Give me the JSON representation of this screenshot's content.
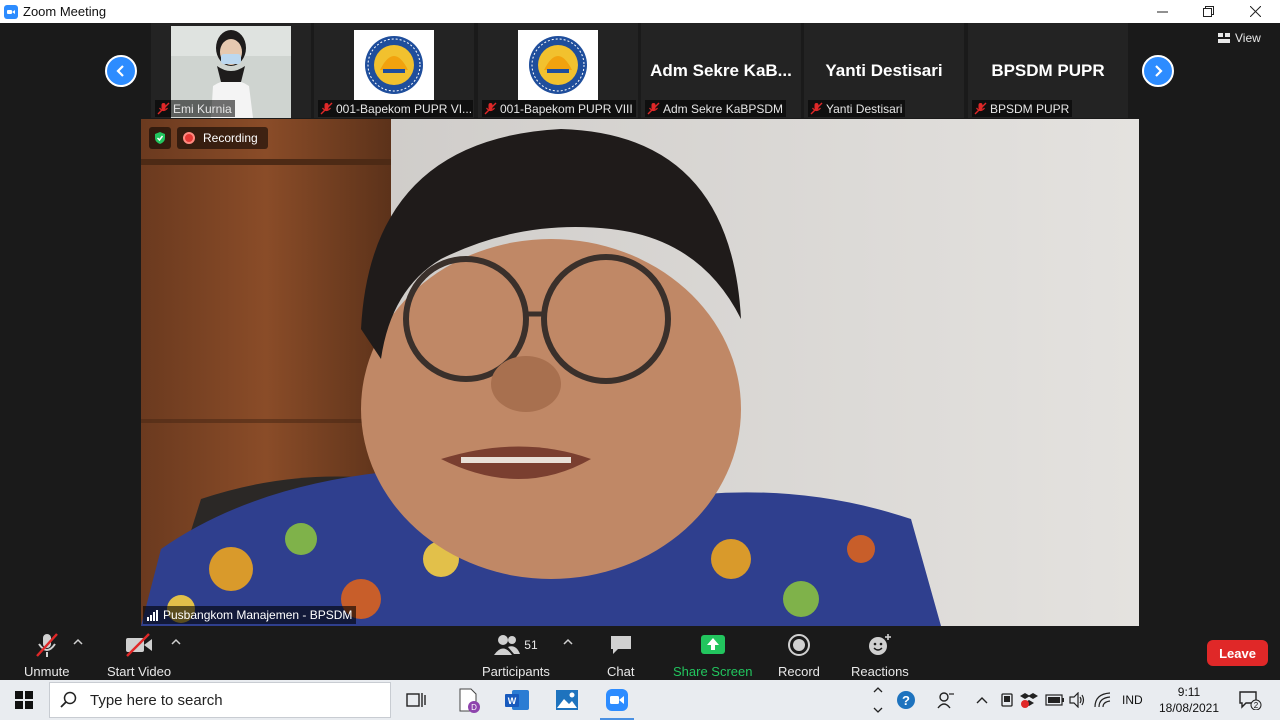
{
  "window": {
    "title": "Zoom Meeting"
  },
  "strip": {
    "tiles": [
      {
        "label": "Emi Kurnia"
      },
      {
        "label": "001-Bapekom PUPR VI..."
      },
      {
        "label": "001-Bapekom PUPR VIII"
      },
      {
        "label": "Adm Sekre KaBPSDM",
        "big": "Adm Sekre KaB..."
      },
      {
        "label": "Yanti Destisari",
        "big": "Yanti Destisari"
      },
      {
        "label": "BPSDM PUPR",
        "big": "BPSDM PUPR"
      }
    ],
    "view_label": "View"
  },
  "main_video": {
    "recording_label": "Recording",
    "speaker": "Pusbangkom Manajemen - BPSDM"
  },
  "toolbar": {
    "unmute": "Unmute",
    "start_video": "Start Video",
    "participants": "Participants",
    "participants_count": "51",
    "chat": "Chat",
    "share_screen": "Share Screen",
    "record": "Record",
    "reactions": "Reactions",
    "leave": "Leave",
    "share_color": "#22c55e",
    "leave_color": "#e02828"
  },
  "taskbar": {
    "search_placeholder": "Type here to search",
    "lang": "IND",
    "time": "9:11",
    "date": "18/08/2021",
    "notif_count": "2",
    "badge_letter": "D"
  }
}
